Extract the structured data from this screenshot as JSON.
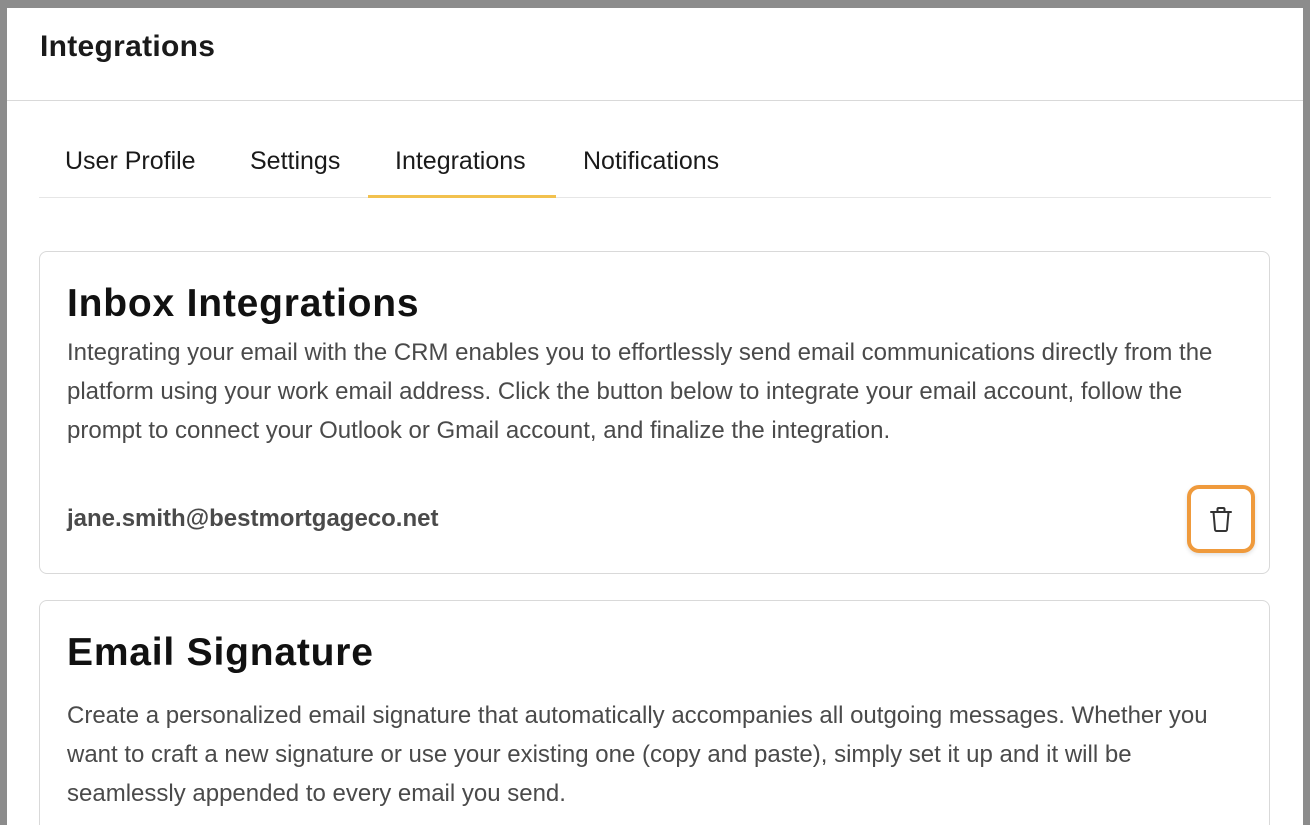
{
  "header": {
    "title": "Integrations"
  },
  "tabs": [
    {
      "label": "User Profile",
      "active": false
    },
    {
      "label": "Settings",
      "active": false
    },
    {
      "label": "Integrations",
      "active": true
    },
    {
      "label": "Notifications",
      "active": false
    }
  ],
  "inbox": {
    "title": "Inbox Integrations",
    "description": "Integrating your email with the CRM enables you to effortlessly send email communications directly from the platform using your work email address. Click the button below to integrate your email account, follow the prompt to connect your Outlook or Gmail account, and finalize the integration.",
    "account_email": "jane.smith@bestmortgageco.net",
    "delete_icon": "trash-icon"
  },
  "signature": {
    "title": "Email Signature",
    "description": "Create a personalized email signature that automatically accompanies all outgoing messages. Whether you want to craft a new signature or use your existing one (copy and paste), simply set it up and it will be seamlessly appended to every email you send."
  },
  "colors": {
    "active_tab_underline": "#f2c14e",
    "highlight_border": "#ef9a3c"
  }
}
